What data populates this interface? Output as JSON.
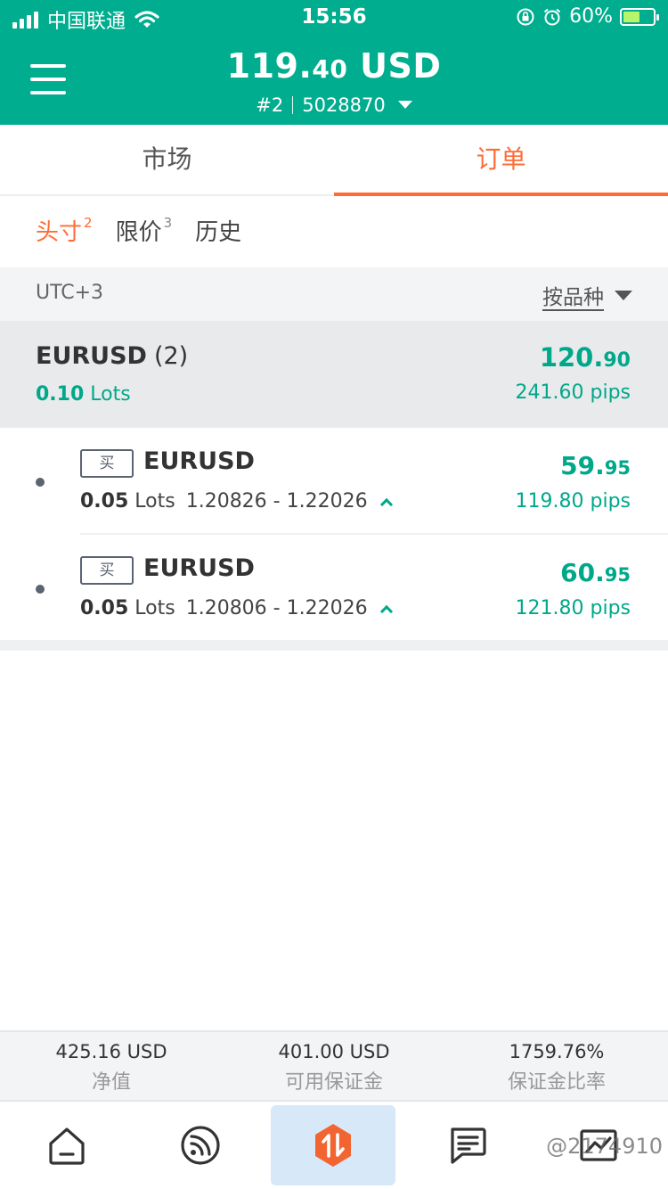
{
  "status_bar": {
    "carrier": "中国联通",
    "time": "15:56",
    "battery_percent": "60%",
    "battery_level": 0.6,
    "icons": [
      "signal-icon",
      "wifi-icon",
      "rotation-lock-icon",
      "alarm-icon",
      "battery-charging-icon"
    ]
  },
  "header": {
    "balance_int": "119.",
    "balance_dec": "40",
    "currency": " USD",
    "account_no": "#2",
    "account_id": "5028870",
    "color": "#00ad8e"
  },
  "tabs": [
    {
      "label": "市场",
      "active": false
    },
    {
      "label": "订单",
      "active": true
    }
  ],
  "subtabs": [
    {
      "label": "头寸",
      "count": "2",
      "active": true
    },
    {
      "label": "限价",
      "count": "3",
      "active": false
    },
    {
      "label": "历史",
      "count": "",
      "active": false
    }
  ],
  "filter": {
    "timezone": "UTC+3",
    "sort_label": "按品种"
  },
  "group": {
    "symbol": "EURUSD",
    "count": "(2)",
    "lots_value": "0.10",
    "lots_unit": " Lots",
    "pnl_int": "120.",
    "pnl_dec": "90",
    "pips": "241.60 pips"
  },
  "positions": [
    {
      "side": "买",
      "symbol": "EURUSD",
      "lots_value": "0.05",
      "lots_unit": " Lots",
      "price_range": "1.20826 - 1.22026",
      "pnl_int": "59.",
      "pnl_dec": "95",
      "pips": "119.80 pips"
    },
    {
      "side": "买",
      "symbol": "EURUSD",
      "lots_value": "0.05",
      "lots_unit": " Lots",
      "price_range": "1.20806 - 1.22026",
      "pnl_int": "60.",
      "pnl_dec": "95",
      "pips": "121.80 pips"
    }
  ],
  "summary": [
    {
      "value": "425.16 USD",
      "label": "净值"
    },
    {
      "value": "401.00 USD",
      "label": "可用保证金"
    },
    {
      "value": "1759.76%",
      "label": "保证金比率"
    }
  ],
  "bottom_nav": [
    {
      "icon": "home-icon",
      "active": false
    },
    {
      "icon": "feed-icon",
      "active": false
    },
    {
      "icon": "trade-icon",
      "active": true
    },
    {
      "icon": "news-icon",
      "active": false
    },
    {
      "icon": "chart-icon",
      "active": false
    }
  ],
  "watermark": "@2174910",
  "colors": {
    "accent_green": "#00a88a",
    "accent_orange": "#ff6b35",
    "trade_icon": "#f26531"
  }
}
